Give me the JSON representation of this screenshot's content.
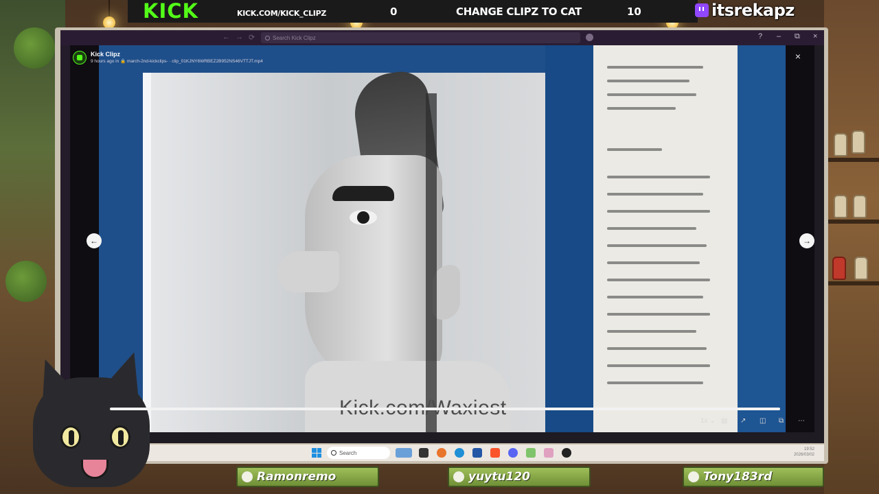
{
  "stream": {
    "kick_logo": "KICK",
    "kick_url": "KICK.COM/KICK_CLIPZ",
    "vote": {
      "left_count": "0",
      "label": "CHANGE CLIPZ TO CAT",
      "right_count": "10"
    },
    "twitch_handle": "itsrekapz"
  },
  "app": {
    "search_placeholder": "Search Kick Clipz",
    "icons": {
      "back": "←",
      "forward": "→",
      "reload": "⟳",
      "help": "?",
      "minimize": "–",
      "restore": "⧉",
      "close": "×"
    }
  },
  "clip": {
    "title": "Kick Clipz",
    "meta": "9 hours ago in 🔒 march-2nd-kickclips- · clip_01KJNY6WRBEZ2B952NS46VTTJT.mp4",
    "watermark": "Kick.com/Waxiest",
    "progress": 1.0,
    "controls": {
      "speed": "1x ⌄",
      "captions": "▤",
      "expand": "↗",
      "theater": "◫",
      "pip": "⧉",
      "more": "⋯"
    },
    "nav": {
      "prev": "←",
      "next": "→"
    }
  },
  "taskbar": {
    "search_label": "Search",
    "clock_time": "19:52",
    "clock_date": "2026/03/02"
  },
  "chat_tags": [
    {
      "name": "Ramonremo",
      "icon": "user-icon"
    },
    {
      "name": "yuytu120",
      "icon": "star-icon"
    },
    {
      "name": "Tony183rd",
      "icon": "dollar-icon"
    }
  ],
  "colors": {
    "kick_green": "#53fc18",
    "twitch_purple": "#9146ff",
    "tag_green": "#8aad4a"
  }
}
